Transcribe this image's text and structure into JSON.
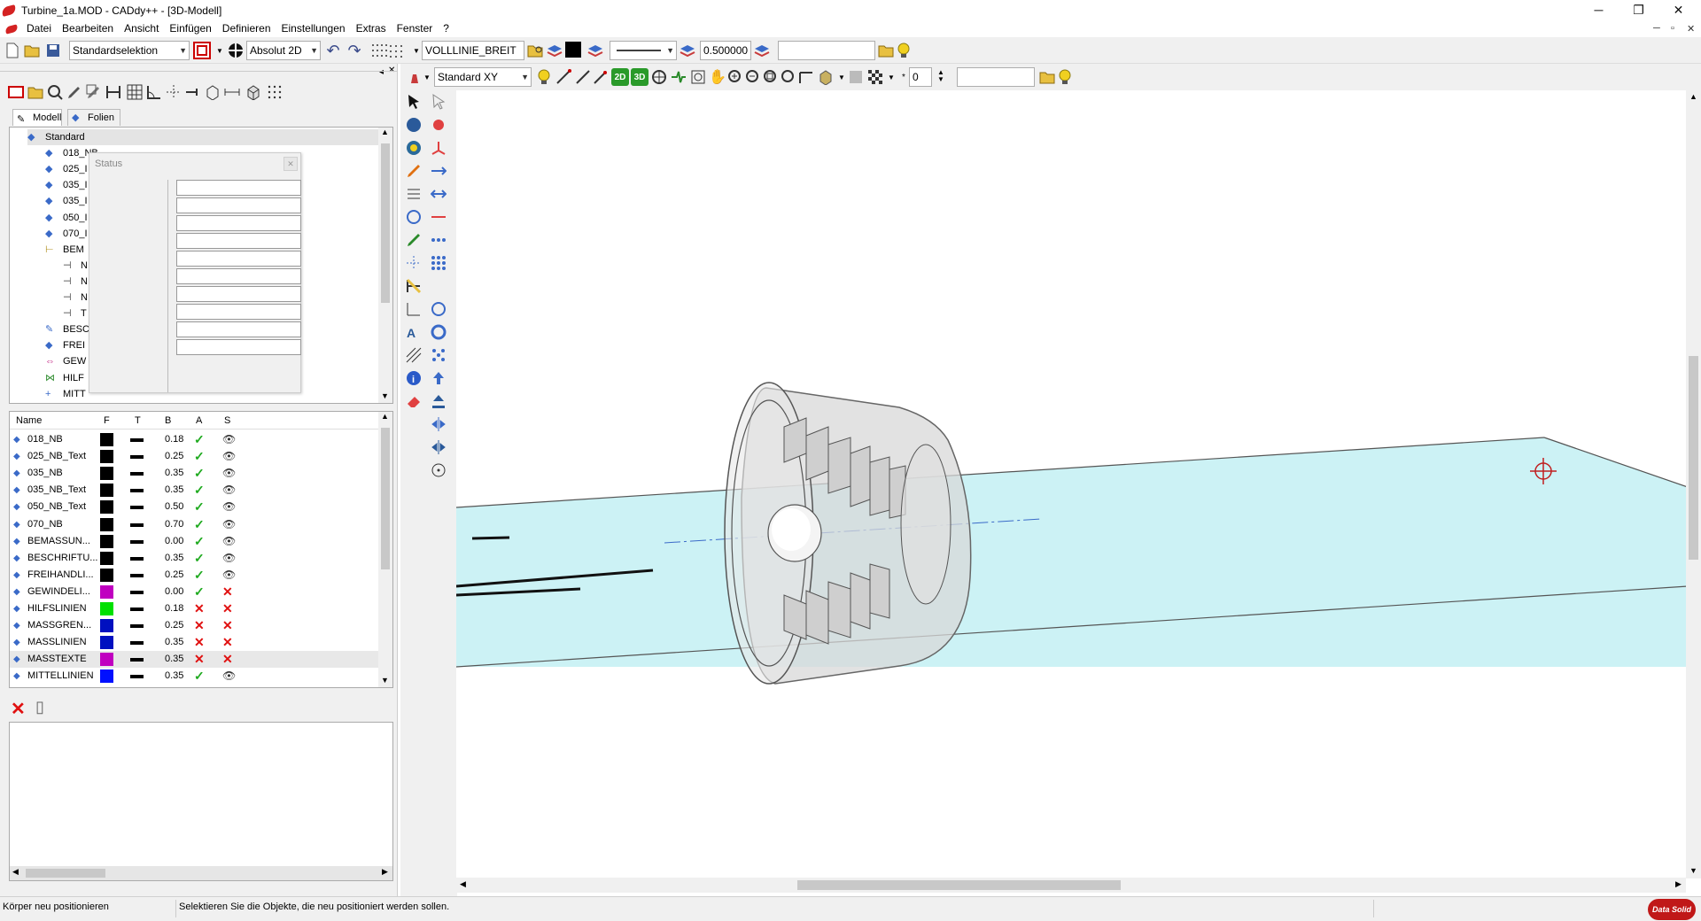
{
  "window": {
    "title": "Turbine_1a.MOD  - CADdy++ - [3D-Modell]",
    "minimize": "─",
    "restore": "❐",
    "close": "✕"
  },
  "menu": {
    "items": [
      "Datei",
      "Bearbeiten",
      "Ansicht",
      "Einfügen",
      "Definieren",
      "Einstellungen",
      "Extras",
      "Fenster",
      "?"
    ],
    "mdi": [
      "─",
      "▫",
      "✕"
    ]
  },
  "toolbar1": {
    "selection_mode": "Standardselektion",
    "coord_mode": "Absolut 2D",
    "line_style_name": "VOLLLINIE_BREIT",
    "line_width": "0.500000",
    "search_value": ""
  },
  "toolbar2": {
    "view_plane": "Standard XY",
    "layer_number": "0",
    "search_value": ""
  },
  "tabs": [
    "Modell",
    "Folien"
  ],
  "tree": {
    "items": [
      {
        "label": "Standard",
        "level": 0,
        "icon": "layers-icon"
      },
      {
        "label": "018_NB",
        "level": 1,
        "icon": "layers-icon"
      },
      {
        "label": "025_I",
        "level": 1,
        "icon": "layers-icon"
      },
      {
        "label": "035_I",
        "level": 1,
        "icon": "layers-icon"
      },
      {
        "label": "035_I",
        "level": 1,
        "icon": "layers-icon"
      },
      {
        "label": "050_I",
        "level": 1,
        "icon": "layers-icon"
      },
      {
        "label": "070_I",
        "level": 1,
        "icon": "layers-icon"
      },
      {
        "label": "BEM",
        "level": 1,
        "icon": "dimension-icon"
      },
      {
        "label": "N",
        "level": 2,
        "icon": "dimline-icon"
      },
      {
        "label": "N",
        "level": 2,
        "icon": "dimline-icon"
      },
      {
        "label": "N",
        "level": 2,
        "icon": "dimline-icon"
      },
      {
        "label": "T",
        "level": 2,
        "icon": "dimline-icon"
      },
      {
        "label": "BESC",
        "level": 1,
        "icon": "annotation-icon"
      },
      {
        "label": "FREI",
        "level": 1,
        "icon": "layers-icon"
      },
      {
        "label": "GEW",
        "level": 1,
        "icon": "thread-icon"
      },
      {
        "label": "HILF",
        "level": 1,
        "icon": "helpline-icon"
      },
      {
        "label": "MITT",
        "level": 1,
        "icon": "centerline-icon"
      }
    ]
  },
  "status_popup": {
    "title": "Status",
    "close": "✕"
  },
  "layers": {
    "headers": [
      "Name",
      "F",
      "T",
      "B",
      "A",
      "S"
    ],
    "rows": [
      {
        "name": "018_NB",
        "color": "#000000",
        "width": "0.18",
        "active": true,
        "visible": true
      },
      {
        "name": "025_NB_Text",
        "color": "#000000",
        "width": "0.25",
        "active": true,
        "visible": true
      },
      {
        "name": "035_NB",
        "color": "#000000",
        "width": "0.35",
        "active": true,
        "visible": true
      },
      {
        "name": "035_NB_Text",
        "color": "#000000",
        "width": "0.35",
        "active": true,
        "visible": true
      },
      {
        "name": "050_NB_Text",
        "color": "#000000",
        "width": "0.50",
        "active": true,
        "visible": true
      },
      {
        "name": "070_NB",
        "color": "#000000",
        "width": "0.70",
        "active": true,
        "visible": true
      },
      {
        "name": "BEMASSUN...",
        "color": "#000000",
        "width": "0.00",
        "active": true,
        "visible": true
      },
      {
        "name": "BESCHRIFTU...",
        "color": "#000000",
        "width": "0.35",
        "active": true,
        "visible": true
      },
      {
        "name": "FREIHANDLI...",
        "color": "#000000",
        "width": "0.25",
        "active": true,
        "visible": true
      },
      {
        "name": "GEWINDELI...",
        "color": "#c000c0",
        "width": "0.00",
        "active": true,
        "visible": false
      },
      {
        "name": "HILFSLINIEN",
        "color": "#00e000",
        "width": "0.18",
        "active": false,
        "visible": false
      },
      {
        "name": "MASSGREN...",
        "color": "#0010c0",
        "width": "0.25",
        "active": false,
        "visible": false
      },
      {
        "name": "MASSLINIEN",
        "color": "#0010c0",
        "width": "0.35",
        "active": false,
        "visible": false
      },
      {
        "name": "MASSTEXTE",
        "color": "#c000c0",
        "width": "0.35",
        "active": false,
        "visible": false
      },
      {
        "name": "MITTELLINIEN",
        "color": "#0010ff",
        "width": "0.35",
        "active": true,
        "visible": true
      }
    ]
  },
  "status": {
    "left": "Körper neu positionieren",
    "right": "Selektieren Sie die Objekte, die neu positioniert werden sollen.",
    "logo": "Data Solid"
  },
  "colors": {
    "plane_fill": "#ccf2f5",
    "accent_red": "#d42222"
  }
}
